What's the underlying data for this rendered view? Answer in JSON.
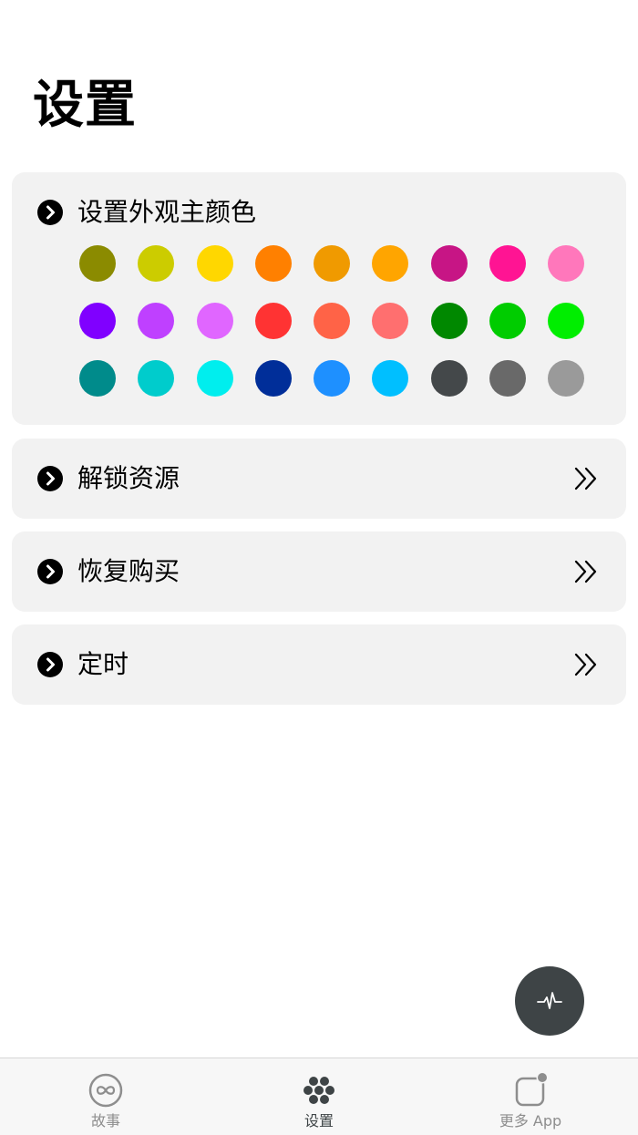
{
  "page": {
    "title": "设置"
  },
  "color_section": {
    "label": "设置外观主颜色",
    "swatches": [
      "#8b8b00",
      "#cccc00",
      "#ffd700",
      "#ff8000",
      "#f09a00",
      "#ffa500",
      "#c71585",
      "#ff1493",
      "#ff77bb",
      "#8000ff",
      "#bf40ff",
      "#e066ff",
      "#ff3333",
      "#ff6347",
      "#ff6f6f",
      "#008800",
      "#00cc00",
      "#00ee00",
      "#008b8b",
      "#00cccc",
      "#00eeee",
      "#002e99",
      "#1e90ff",
      "#00bfff",
      "#44484a",
      "#696969",
      "#9a9a9a"
    ]
  },
  "rows": {
    "unlock": {
      "label": "解锁资源"
    },
    "restore": {
      "label": "恢复购买"
    },
    "timer": {
      "label": "定时"
    }
  },
  "fab": {
    "icon": "pulse-icon"
  },
  "tabbar": {
    "stories": {
      "label": "故事",
      "icon": "infinity-icon"
    },
    "settings": {
      "label": "设置",
      "icon": "dots-grid-icon"
    },
    "more": {
      "label": "更多 App",
      "icon": "app-badge-icon"
    }
  },
  "colors": {
    "card_bg": "#f2f2f2",
    "fab_bg": "#3e4446",
    "tab_active": "#3e4446",
    "tab_inactive": "#8e8e8e"
  }
}
